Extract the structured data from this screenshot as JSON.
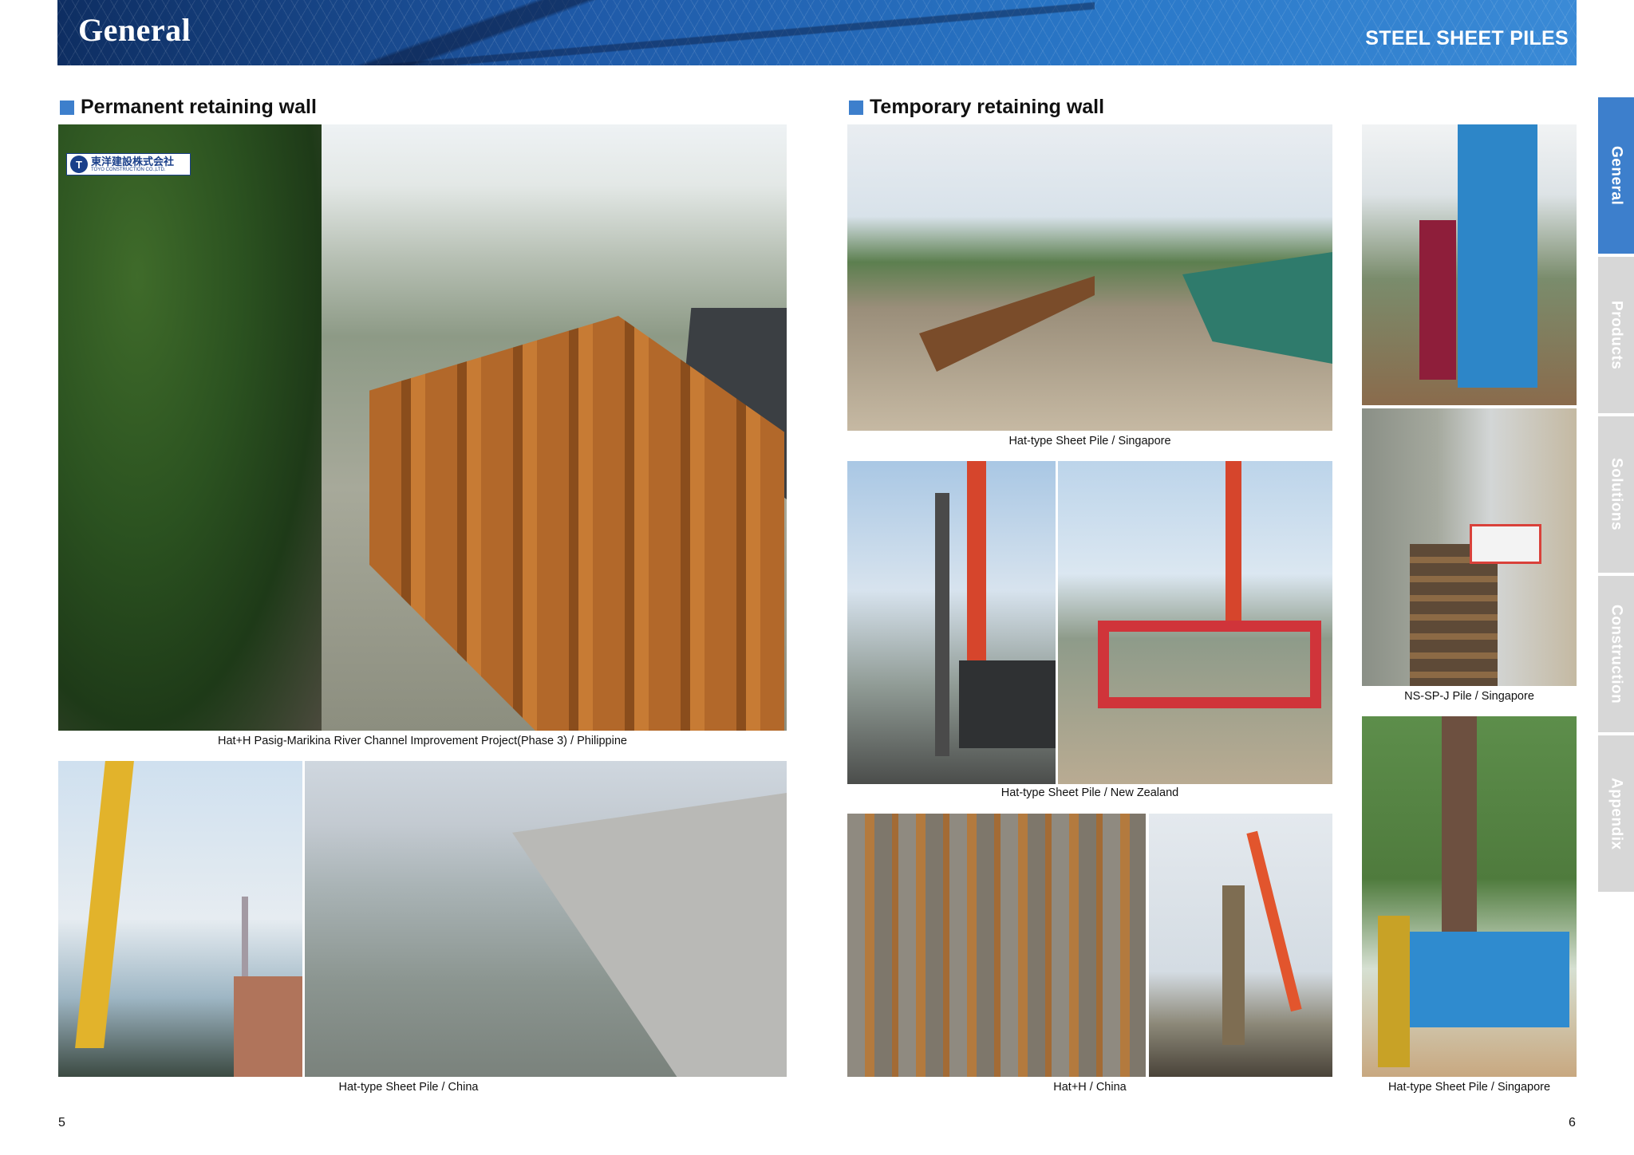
{
  "header": {
    "title": "General",
    "product": "STEEL SHEET PILES"
  },
  "sections": {
    "permanent": {
      "heading": "Permanent retaining wall",
      "logo_text": "東洋建設株式会社",
      "logo_subtext": "TOYO CONSTRUCTION CO.,LTD.",
      "caption_main": "Hat+H   Pasig-Marikina River Channel Improvement Project(Phase 3) / Philippine",
      "caption_bottom": "Hat-type Sheet Pile / China"
    },
    "temporary": {
      "heading": "Temporary retaining wall",
      "captions": {
        "singapore_top": "Hat-type Sheet Pile / Singapore",
        "new_zealand": "Hat-type Sheet Pile / New Zealand",
        "china": "Hat+H / China",
        "nssp_singapore": "NS-SP-J Pile / Singapore",
        "singapore_bottom": "Hat-type Sheet Pile / Singapore"
      }
    }
  },
  "pages": {
    "left": "5",
    "right": "6"
  },
  "side_tabs": [
    {
      "label": "General",
      "active": true
    },
    {
      "label": "Products",
      "active": false
    },
    {
      "label": "Solutions",
      "active": false
    },
    {
      "label": "Construction",
      "active": false
    },
    {
      "label": "Appendix",
      "active": false
    }
  ],
  "colors": {
    "accent_blue": "#3d7fcc",
    "tab_inactive": "#d7d7d7",
    "banner_dark": "#0e2e62"
  }
}
